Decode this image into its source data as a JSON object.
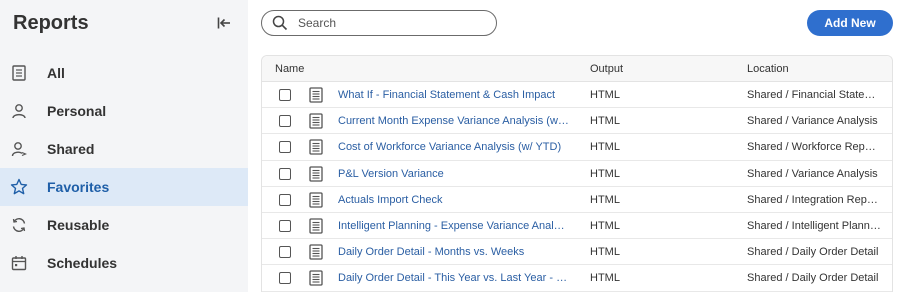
{
  "sidebar": {
    "title": "Reports",
    "items": [
      {
        "label": "All",
        "icon": "document-icon",
        "active": false
      },
      {
        "label": "Personal",
        "icon": "person-icon",
        "active": false
      },
      {
        "label": "Shared",
        "icon": "shared-person-icon",
        "active": false
      },
      {
        "label": "Favorites",
        "icon": "star-icon",
        "active": true
      },
      {
        "label": "Reusable",
        "icon": "refresh-icon",
        "active": false
      },
      {
        "label": "Schedules",
        "icon": "calendar-icon",
        "active": false
      }
    ]
  },
  "search": {
    "placeholder": "Search",
    "value": ""
  },
  "toolbar": {
    "add_label": "Add New"
  },
  "table": {
    "headers": {
      "name": "Name",
      "output": "Output",
      "location": "Location"
    },
    "rows": [
      {
        "name": "What If - Financial Statement & Cash Impact",
        "output": "HTML",
        "location": "Shared / Financial Stateme…"
      },
      {
        "name": "Current Month Expense Variance Analysis (w/ YT…",
        "output": "HTML",
        "location": "Shared / Variance Analysis"
      },
      {
        "name": "Cost of Workforce Variance Analysis (w/ YTD)",
        "output": "HTML",
        "location": "Shared / Workforce Reports"
      },
      {
        "name": "P&L Version Variance",
        "output": "HTML",
        "location": "Shared / Variance Analysis"
      },
      {
        "name": "Actuals Import Check",
        "output": "HTML",
        "location": "Shared / Integration Reports"
      },
      {
        "name": "Intelligent Planning - Expense Variance Analysis",
        "output": "HTML",
        "location": "Shared / Intelligent Planning"
      },
      {
        "name": "Daily Order Detail - Months vs. Weeks",
        "output": "HTML",
        "location": "Shared / Daily Order Detail"
      },
      {
        "name": "Daily Order Detail - This Year vs. Last Year - Sum…",
        "output": "HTML",
        "location": "Shared / Daily Order Detail"
      }
    ]
  },
  "colors": {
    "accent": "#2f6fce",
    "link": "#2a5ea3",
    "active_bg": "#dde9f7",
    "sidebar_bg": "#f4f5f7"
  }
}
